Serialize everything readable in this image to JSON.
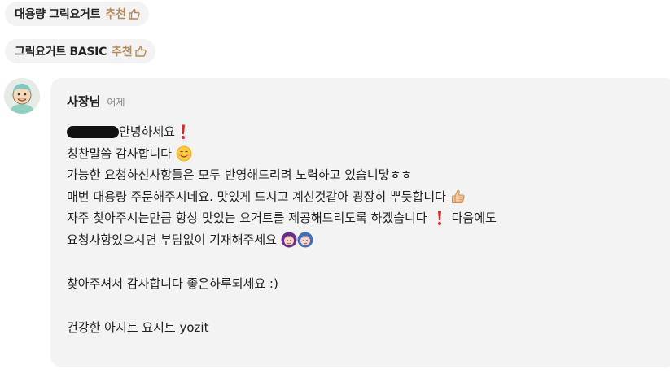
{
  "chips": [
    {
      "name": "대용량 그릭요거트",
      "recommend_label": "추천"
    },
    {
      "name": "그릭요거트 BASIC",
      "recommend_label": "추천"
    }
  ],
  "reply": {
    "author": "사장님",
    "time": "어제",
    "lines": [
      "안녕하세요",
      "칭찬말씀 감사합니다",
      "가능한 요청하신사항들은 모두 반영해드리려 노력하고 있습니닿ㅎㅎ",
      "매번 대용량 주문해주시네요. 맛있게 드시고 계신것같아 굉장히 뿌듯합니다",
      "자주 찾아주시는만큼 항상 맛있는 요거트를 제공해드리도록 하겠습니다",
      "다음에도",
      "요청사항있으시면 부담없이 기재해주세요",
      "찾아주셔서 감사합니다 좋은하루되세요 :)",
      "건강한 아지트 요지트 yozit"
    ]
  },
  "icons": {
    "thumb": "thumbs-up-outline-icon",
    "exclamation": "red-exclamation-icon",
    "smile": "smiling-face-icon",
    "thumbs_up_emoji": "thumbs-up-emoji-icon",
    "girls": "two-girls-emoji-icon"
  },
  "colors": {
    "recommend": "#b58a5a",
    "bubble": "#f3f3f3",
    "chip": "#f3f3f3",
    "exclamation": "#e0242b",
    "redaction": "#111111"
  }
}
